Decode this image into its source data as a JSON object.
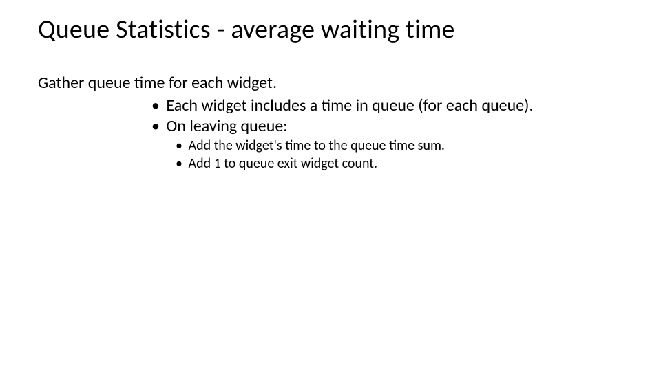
{
  "title": "Queue Statistics  - average waiting time",
  "intro": "Gather queue time for each widget.",
  "bullets_l1": [
    "Each widget includes a time in queue (for each queue).",
    "On leaving queue:"
  ],
  "bullets_l2": [
    "Add the widget's time to the queue time sum.",
    "Add 1 to queue exit widget count."
  ]
}
